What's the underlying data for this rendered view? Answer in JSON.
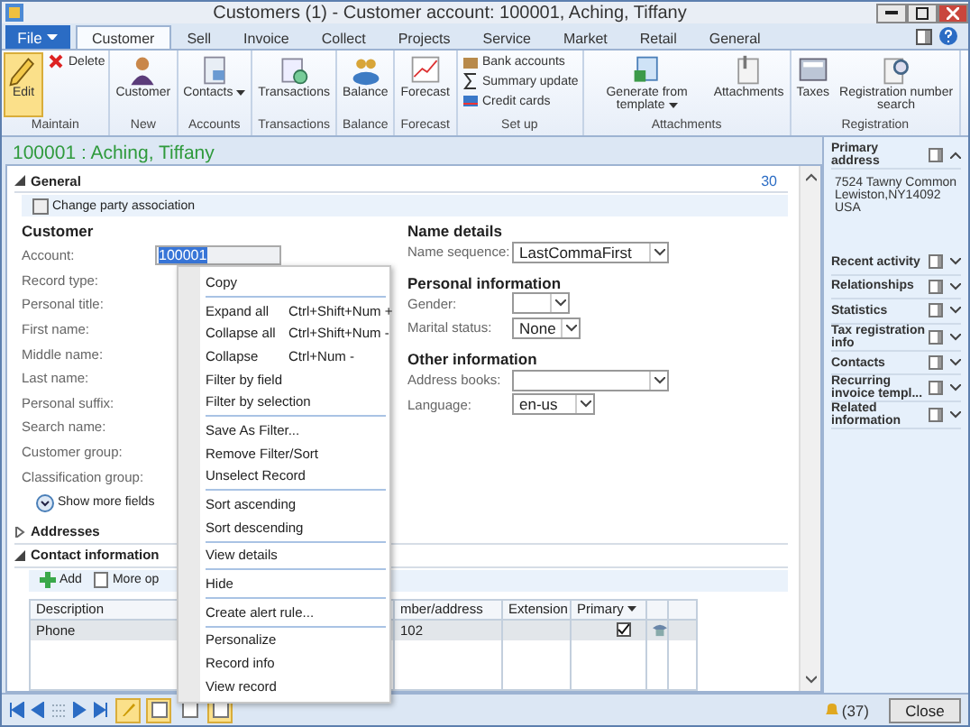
{
  "window": {
    "title": "Customers (1) - Customer account: 100001, Aching, Tiffany"
  },
  "file_button": {
    "label": "File"
  },
  "ribbon_tabs": [
    {
      "label": "Customer",
      "selected": true
    },
    {
      "label": "Sell",
      "selected": false
    },
    {
      "label": "Invoice",
      "selected": false
    },
    {
      "label": "Collect",
      "selected": false
    },
    {
      "label": "Projects",
      "selected": false
    },
    {
      "label": "Service",
      "selected": false
    },
    {
      "label": "Market",
      "selected": false
    },
    {
      "label": "Retail",
      "selected": false
    },
    {
      "label": "General",
      "selected": false
    }
  ],
  "ribbon_groups": [
    {
      "label": "Maintain",
      "buttons": [
        {
          "label": "Edit",
          "kind": "large",
          "selected": true
        },
        {
          "label": "Delete",
          "kind": "small",
          "selected": false
        }
      ]
    },
    {
      "label": "New",
      "buttons": [
        {
          "label": "Customer",
          "kind": "large",
          "selected": false
        }
      ]
    },
    {
      "label": "Accounts",
      "buttons": [
        {
          "label": "Contacts",
          "kind": "large",
          "selected": false,
          "dropdown": true
        }
      ]
    },
    {
      "label": "Transactions",
      "buttons": [
        {
          "label": "Transactions",
          "kind": "large",
          "selected": false
        }
      ]
    },
    {
      "label": "Balance",
      "buttons": [
        {
          "label": "Balance",
          "kind": "large",
          "selected": false
        }
      ]
    },
    {
      "label": "Forecast",
      "buttons": [
        {
          "label": "Forecast",
          "kind": "large",
          "selected": false
        }
      ]
    },
    {
      "label": "Set up",
      "buttons": [
        {
          "label": "Bank accounts",
          "kind": "small",
          "selected": false
        },
        {
          "label": "Summary update",
          "kind": "small",
          "selected": false
        },
        {
          "label": "Credit cards",
          "kind": "small",
          "selected": false
        }
      ]
    },
    {
      "label": "Attachments",
      "buttons": [
        {
          "label": "Generate from template",
          "kind": "large",
          "selected": false,
          "dropdown": true
        },
        {
          "label": "Attachments",
          "kind": "large",
          "selected": false
        }
      ]
    },
    {
      "label": "Registration",
      "buttons": [
        {
          "label": "Taxes",
          "kind": "large",
          "selected": false
        },
        {
          "label": "Registration number search",
          "kind": "large",
          "selected": false
        }
      ]
    }
  ],
  "record_title": "100001 : Aching, Tiffany",
  "general": {
    "title": "General",
    "expanded": true,
    "page": "30",
    "action": "Change party association",
    "customer": {
      "title": "Customer",
      "fields": [
        {
          "label": "Account:",
          "value": "100001",
          "selected": true
        },
        {
          "label": "Record type:"
        },
        {
          "label": "Personal title:"
        },
        {
          "label": "First name:"
        },
        {
          "label": "Middle name:"
        },
        {
          "label": "Last name:"
        },
        {
          "label": "Personal suffix:"
        },
        {
          "label": "Search name:"
        },
        {
          "label": "Customer group:"
        },
        {
          "label": "Classification group:"
        }
      ],
      "more": "Show more fields"
    },
    "groups": [
      {
        "title": "Name details",
        "fields": [
          {
            "label": "Name sequence:",
            "value": "LastCommaFirst"
          }
        ]
      },
      {
        "title": "Personal information",
        "fields": [
          {
            "label": "Gender:"
          },
          {
            "label": "Marital status:",
            "value": "None"
          }
        ]
      },
      {
        "title": "Other information",
        "fields": [
          {
            "label": "Address books:"
          },
          {
            "label": "Language:",
            "value": "en-us"
          }
        ]
      }
    ]
  },
  "addresses": {
    "title": "Addresses",
    "expanded": false
  },
  "contact_information": {
    "title": "Contact information",
    "expanded": true,
    "actions": [
      "Add",
      "More op"
    ],
    "columns": [
      "Description",
      "",
      "mber/address",
      "Extension",
      "Primary"
    ],
    "rows": [
      {
        "description": "Phone",
        "number": "102",
        "primary": true,
        "selected": true
      }
    ]
  },
  "context_menu": [
    [
      {
        "label": "Copy"
      }
    ],
    [
      {
        "label": "Expand all",
        "shortcut": "Ctrl+Shift+Num +"
      },
      {
        "label": "Collapse all",
        "shortcut": "Ctrl+Shift+Num -"
      },
      {
        "label": "Collapse",
        "shortcut": "Ctrl+Num -"
      },
      {
        "label": "Filter by field"
      },
      {
        "label": "Filter by selection"
      }
    ],
    [
      {
        "label": "Save As Filter..."
      },
      {
        "label": "Remove Filter/Sort"
      },
      {
        "label": "Unselect Record"
      }
    ],
    [
      {
        "label": "Sort ascending"
      },
      {
        "label": "Sort descending"
      }
    ],
    [
      {
        "label": "View details"
      }
    ],
    [
      {
        "label": "Hide"
      }
    ],
    [
      {
        "label": "Create alert rule..."
      }
    ],
    [
      {
        "label": "Personalize"
      },
      {
        "label": "Record info"
      },
      {
        "label": "View record"
      }
    ]
  ],
  "factbox": [
    {
      "title": "Primary address",
      "expanded": true,
      "lines": [
        "7524 Tawny Common",
        "Lewiston,NY14092",
        "USA"
      ]
    },
    {
      "title": "Recent activity",
      "expanded": false
    },
    {
      "title": "Relationships",
      "expanded": false
    },
    {
      "title": "Statistics",
      "expanded": false
    },
    {
      "title": "Tax registration info",
      "expanded": false
    },
    {
      "title": "Contacts",
      "expanded": false
    },
    {
      "title": "Recurring invoice templ...",
      "expanded": false
    },
    {
      "title": "Related information",
      "expanded": false
    }
  ],
  "status_bar": {
    "tools": [
      {
        "selected": true
      },
      {
        "selected": true
      },
      {
        "selected": false
      },
      {
        "selected": true
      }
    ],
    "alerts": "(37)",
    "close": "Close"
  }
}
